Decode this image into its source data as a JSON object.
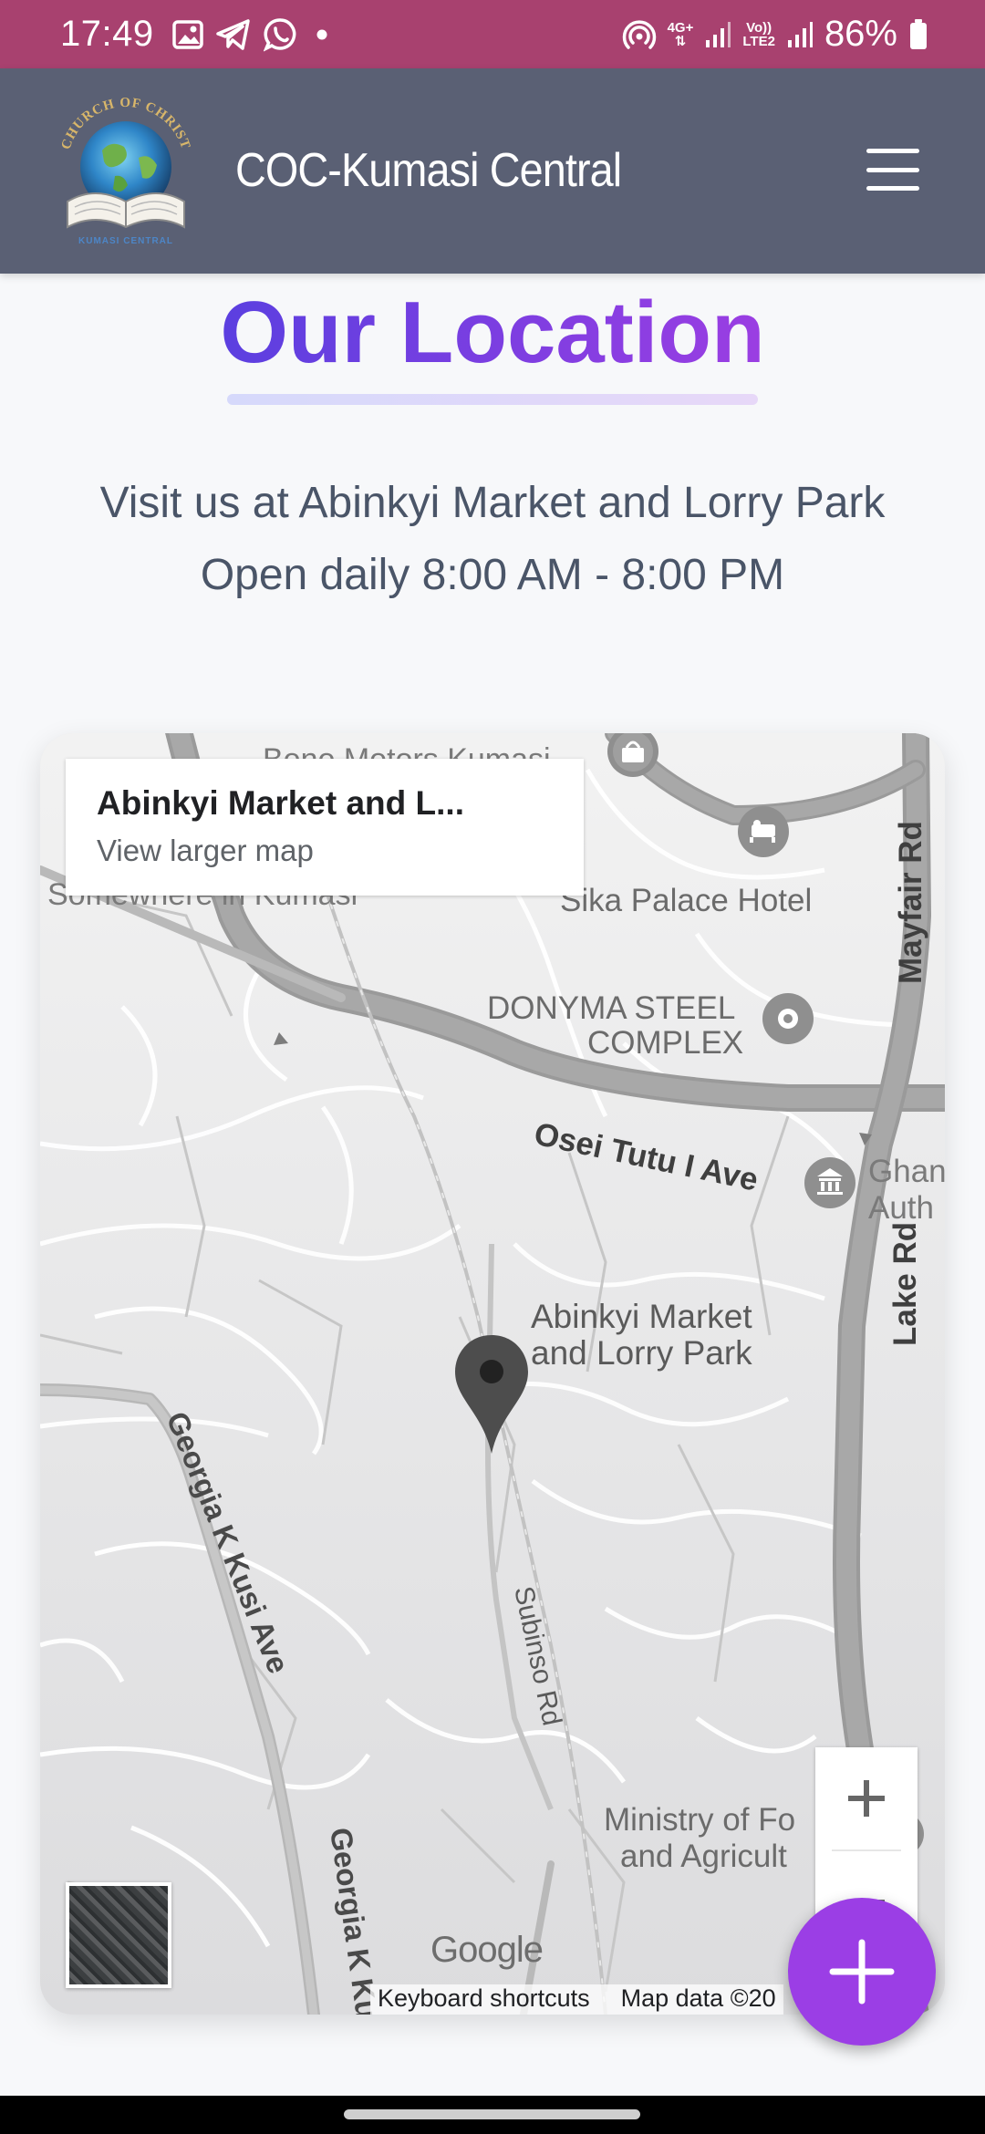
{
  "status_bar": {
    "time": "17:49",
    "network_top": "4G+",
    "volte_top": "Vo))",
    "volte_bottom": "LTE2",
    "battery": "86%",
    "icons": [
      "gallery-icon",
      "telegram-icon",
      "whatsapp-icon",
      "dot-icon",
      "hotspot-icon",
      "signal-icon",
      "battery-icon"
    ]
  },
  "header": {
    "logo_text_top": "CHURCH OF CHRIST",
    "logo_text_bottom": "KUMASI CENTRAL",
    "title": "COC-Kumasi Central",
    "menu_icon": "hamburger-icon"
  },
  "section": {
    "title": "Our Location",
    "address_line": "Visit us at Abinkyi Market and Lorry Park",
    "hours_line": "Open daily 8:00 AM - 8:00 PM"
  },
  "map": {
    "place_name": "Abinkyi Market and L...",
    "view_larger": "View larger map",
    "labels": {
      "bono_motors": "Bono Motors Kumasi",
      "somewhere": "Somewhere in Kumasi",
      "sika_palace": "Sika Palace Hotel",
      "donyma_1": "DONYMA STEEL",
      "donyma_2": "COMPLEX",
      "osei_tutu": "Osei Tutu I Ave",
      "ghana_auth_1": "Ghan",
      "ghana_auth_2": "Auth",
      "abinkyi_1": "Abinkyi Market",
      "abinkyi_2": "and Lorry Park",
      "lake_rd": "Lake Rd",
      "georgia_1": "Georgia K Kusi Ave",
      "georgia_2": "Georgia K Ku",
      "subinso": "Subinso Rd",
      "ministry_1": "Ministry of Fo",
      "ministry_2": "and Agricult",
      "mayfair": "Mayfair Rd"
    },
    "google_logo": "Google",
    "keyboard_shortcuts": "Keyboard shortcuts",
    "map_data": "Map data ©20",
    "zoom_in": "+",
    "zoom_out": "−"
  },
  "fab": {
    "icon": "plus-icon"
  }
}
